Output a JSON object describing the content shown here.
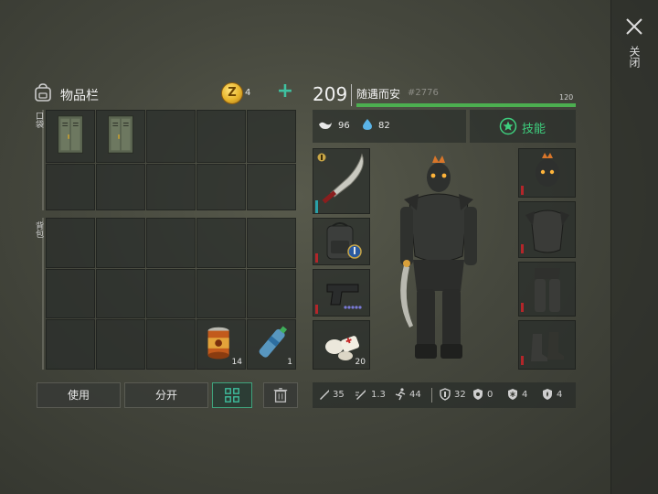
{
  "close": {
    "label": "关闭"
  },
  "inventory": {
    "title": "物品栏",
    "coin_symbol": "Z",
    "coin_count": "4",
    "add_symbol": "+",
    "pocket_label": "口袋",
    "bag_label": "背包",
    "pocket_slots": [
      {
        "item": "metal-locker",
        "qty": ""
      },
      {
        "item": "metal-locker",
        "qty": ""
      },
      {
        "item": "",
        "qty": ""
      },
      {
        "item": "",
        "qty": ""
      },
      {
        "item": "",
        "qty": ""
      },
      {
        "item": "",
        "qty": ""
      },
      {
        "item": "",
        "qty": ""
      },
      {
        "item": "",
        "qty": ""
      },
      {
        "item": "",
        "qty": ""
      },
      {
        "item": "",
        "qty": ""
      }
    ],
    "bag_slots": [
      {
        "item": "",
        "qty": ""
      },
      {
        "item": "",
        "qty": ""
      },
      {
        "item": "",
        "qty": ""
      },
      {
        "item": "",
        "qty": ""
      },
      {
        "item": "",
        "qty": ""
      },
      {
        "item": "",
        "qty": ""
      },
      {
        "item": "",
        "qty": ""
      },
      {
        "item": "",
        "qty": ""
      },
      {
        "item": "",
        "qty": ""
      },
      {
        "item": "",
        "qty": ""
      },
      {
        "item": "",
        "qty": ""
      },
      {
        "item": "",
        "qty": ""
      },
      {
        "item": "",
        "qty": ""
      },
      {
        "item": "canned-food",
        "qty": "14"
      },
      {
        "item": "water-bottle",
        "qty": "1"
      }
    ],
    "buttons": {
      "use": "使用",
      "split": "分开"
    }
  },
  "character": {
    "level": "209",
    "name": "随遇而安",
    "id": "#2776",
    "xp_max": "120",
    "xp_fraction": 1.0,
    "food": "96",
    "water": "82",
    "skill_label": "技能",
    "weapon_slots": [
      {
        "item": "machete",
        "qty": ""
      },
      {
        "item": "backpack",
        "qty": ""
      },
      {
        "item": "pistol",
        "qty": ""
      },
      {
        "item": "bandage",
        "qty": "20"
      }
    ],
    "armor_slots": [
      {
        "item": "spiked-helmet"
      },
      {
        "item": "armored-vest"
      },
      {
        "item": "armored-pants"
      },
      {
        "item": "armored-boots"
      }
    ],
    "stats": [
      {
        "icon": "melee-damage-icon",
        "value": "35"
      },
      {
        "icon": "attack-speed-icon",
        "value": "1.3"
      },
      {
        "icon": "move-speed-icon",
        "value": "44"
      },
      {
        "icon": "armor-icon",
        "value": "32"
      },
      {
        "icon": "bio-resist-icon",
        "value": "0"
      },
      {
        "icon": "cold-resist-icon",
        "value": "4"
      },
      {
        "icon": "heat-resist-icon",
        "value": "4"
      }
    ]
  },
  "colors": {
    "accent_green": "#3ecf7e",
    "xp_green": "#4caf50",
    "coin_gold": "#e8b52b",
    "durability_red": "#b3262a"
  }
}
